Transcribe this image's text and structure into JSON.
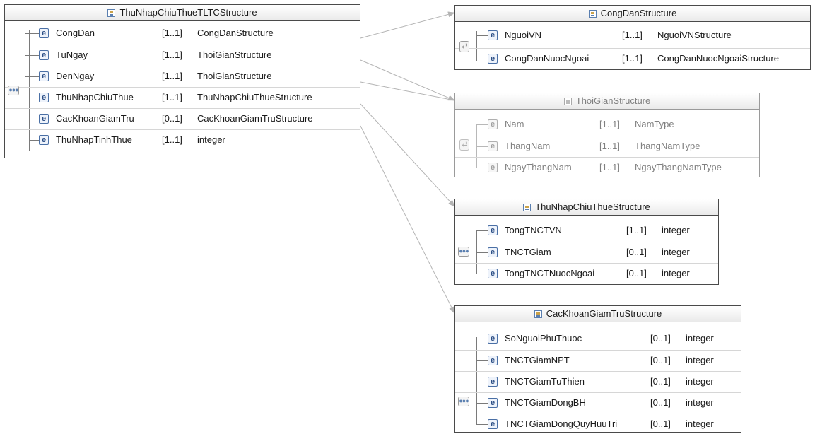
{
  "root": {
    "title": "ThuNhapChiuThueTLTCStructure",
    "compositor": "sequence",
    "elements": [
      {
        "name": "CongDan",
        "card": "[1..1]",
        "type": "CongDanStructure"
      },
      {
        "name": "TuNgay",
        "card": "[1..1]",
        "type": "ThoiGianStructure"
      },
      {
        "name": "DenNgay",
        "card": "[1..1]",
        "type": "ThoiGianStructure"
      },
      {
        "name": "ThuNhapChiuThue",
        "card": "[1..1]",
        "type": "ThuNhapChiuThueStructure"
      },
      {
        "name": "CacKhoanGiamTru",
        "card": "[0..1]",
        "type": "CacKhoanGiamTruStructure"
      },
      {
        "name": "ThuNhapTinhThue",
        "card": "[1..1]",
        "type": "integer"
      }
    ]
  },
  "congdan": {
    "title": "CongDanStructure",
    "compositor": "choice",
    "elements": [
      {
        "name": "NguoiVN",
        "card": "[1..1]",
        "type": "NguoiVNStructure"
      },
      {
        "name": "CongDanNuocNgoai",
        "card": "[1..1]",
        "type": "CongDanNuocNgoaiStructure"
      }
    ]
  },
  "thoigian": {
    "title": "ThoiGianStructure",
    "compositor": "choice",
    "elements": [
      {
        "name": "Nam",
        "card": "[1..1]",
        "type": "NamType"
      },
      {
        "name": "ThangNam",
        "card": "[1..1]",
        "type": "ThangNamType"
      },
      {
        "name": "NgayThangNam",
        "card": "[1..1]",
        "type": "NgayThangNamType"
      }
    ]
  },
  "thunhap": {
    "title": "ThuNhapChiuThueStructure",
    "compositor": "sequence",
    "elements": [
      {
        "name": "TongTNCTVN",
        "card": "[1..1]",
        "type": "integer"
      },
      {
        "name": "TNCTGiam",
        "card": "[0..1]",
        "type": "integer"
      },
      {
        "name": "TongTNCTNuocNgoai",
        "card": "[0..1]",
        "type": "integer"
      }
    ]
  },
  "giamtru": {
    "title": "CacKhoanGiamTruStructure",
    "compositor": "sequence",
    "elements": [
      {
        "name": "SoNguoiPhuThuoc",
        "card": "[0..1]",
        "type": "integer"
      },
      {
        "name": "TNCTGiamNPT",
        "card": "[0..1]",
        "type": "integer"
      },
      {
        "name": "TNCTGiamTuThien",
        "card": "[0..1]",
        "type": "integer"
      },
      {
        "name": "TNCTGiamDongBH",
        "card": "[0..1]",
        "type": "integer"
      },
      {
        "name": "TNCTGiamDongQuyHuuTri",
        "card": "[0..1]",
        "type": "integer"
      }
    ]
  },
  "element_icon_letter": "e",
  "colors": {
    "connector": "#b4b4b4",
    "border": "#4a4a4a",
    "icon": "#2c4f86"
  }
}
